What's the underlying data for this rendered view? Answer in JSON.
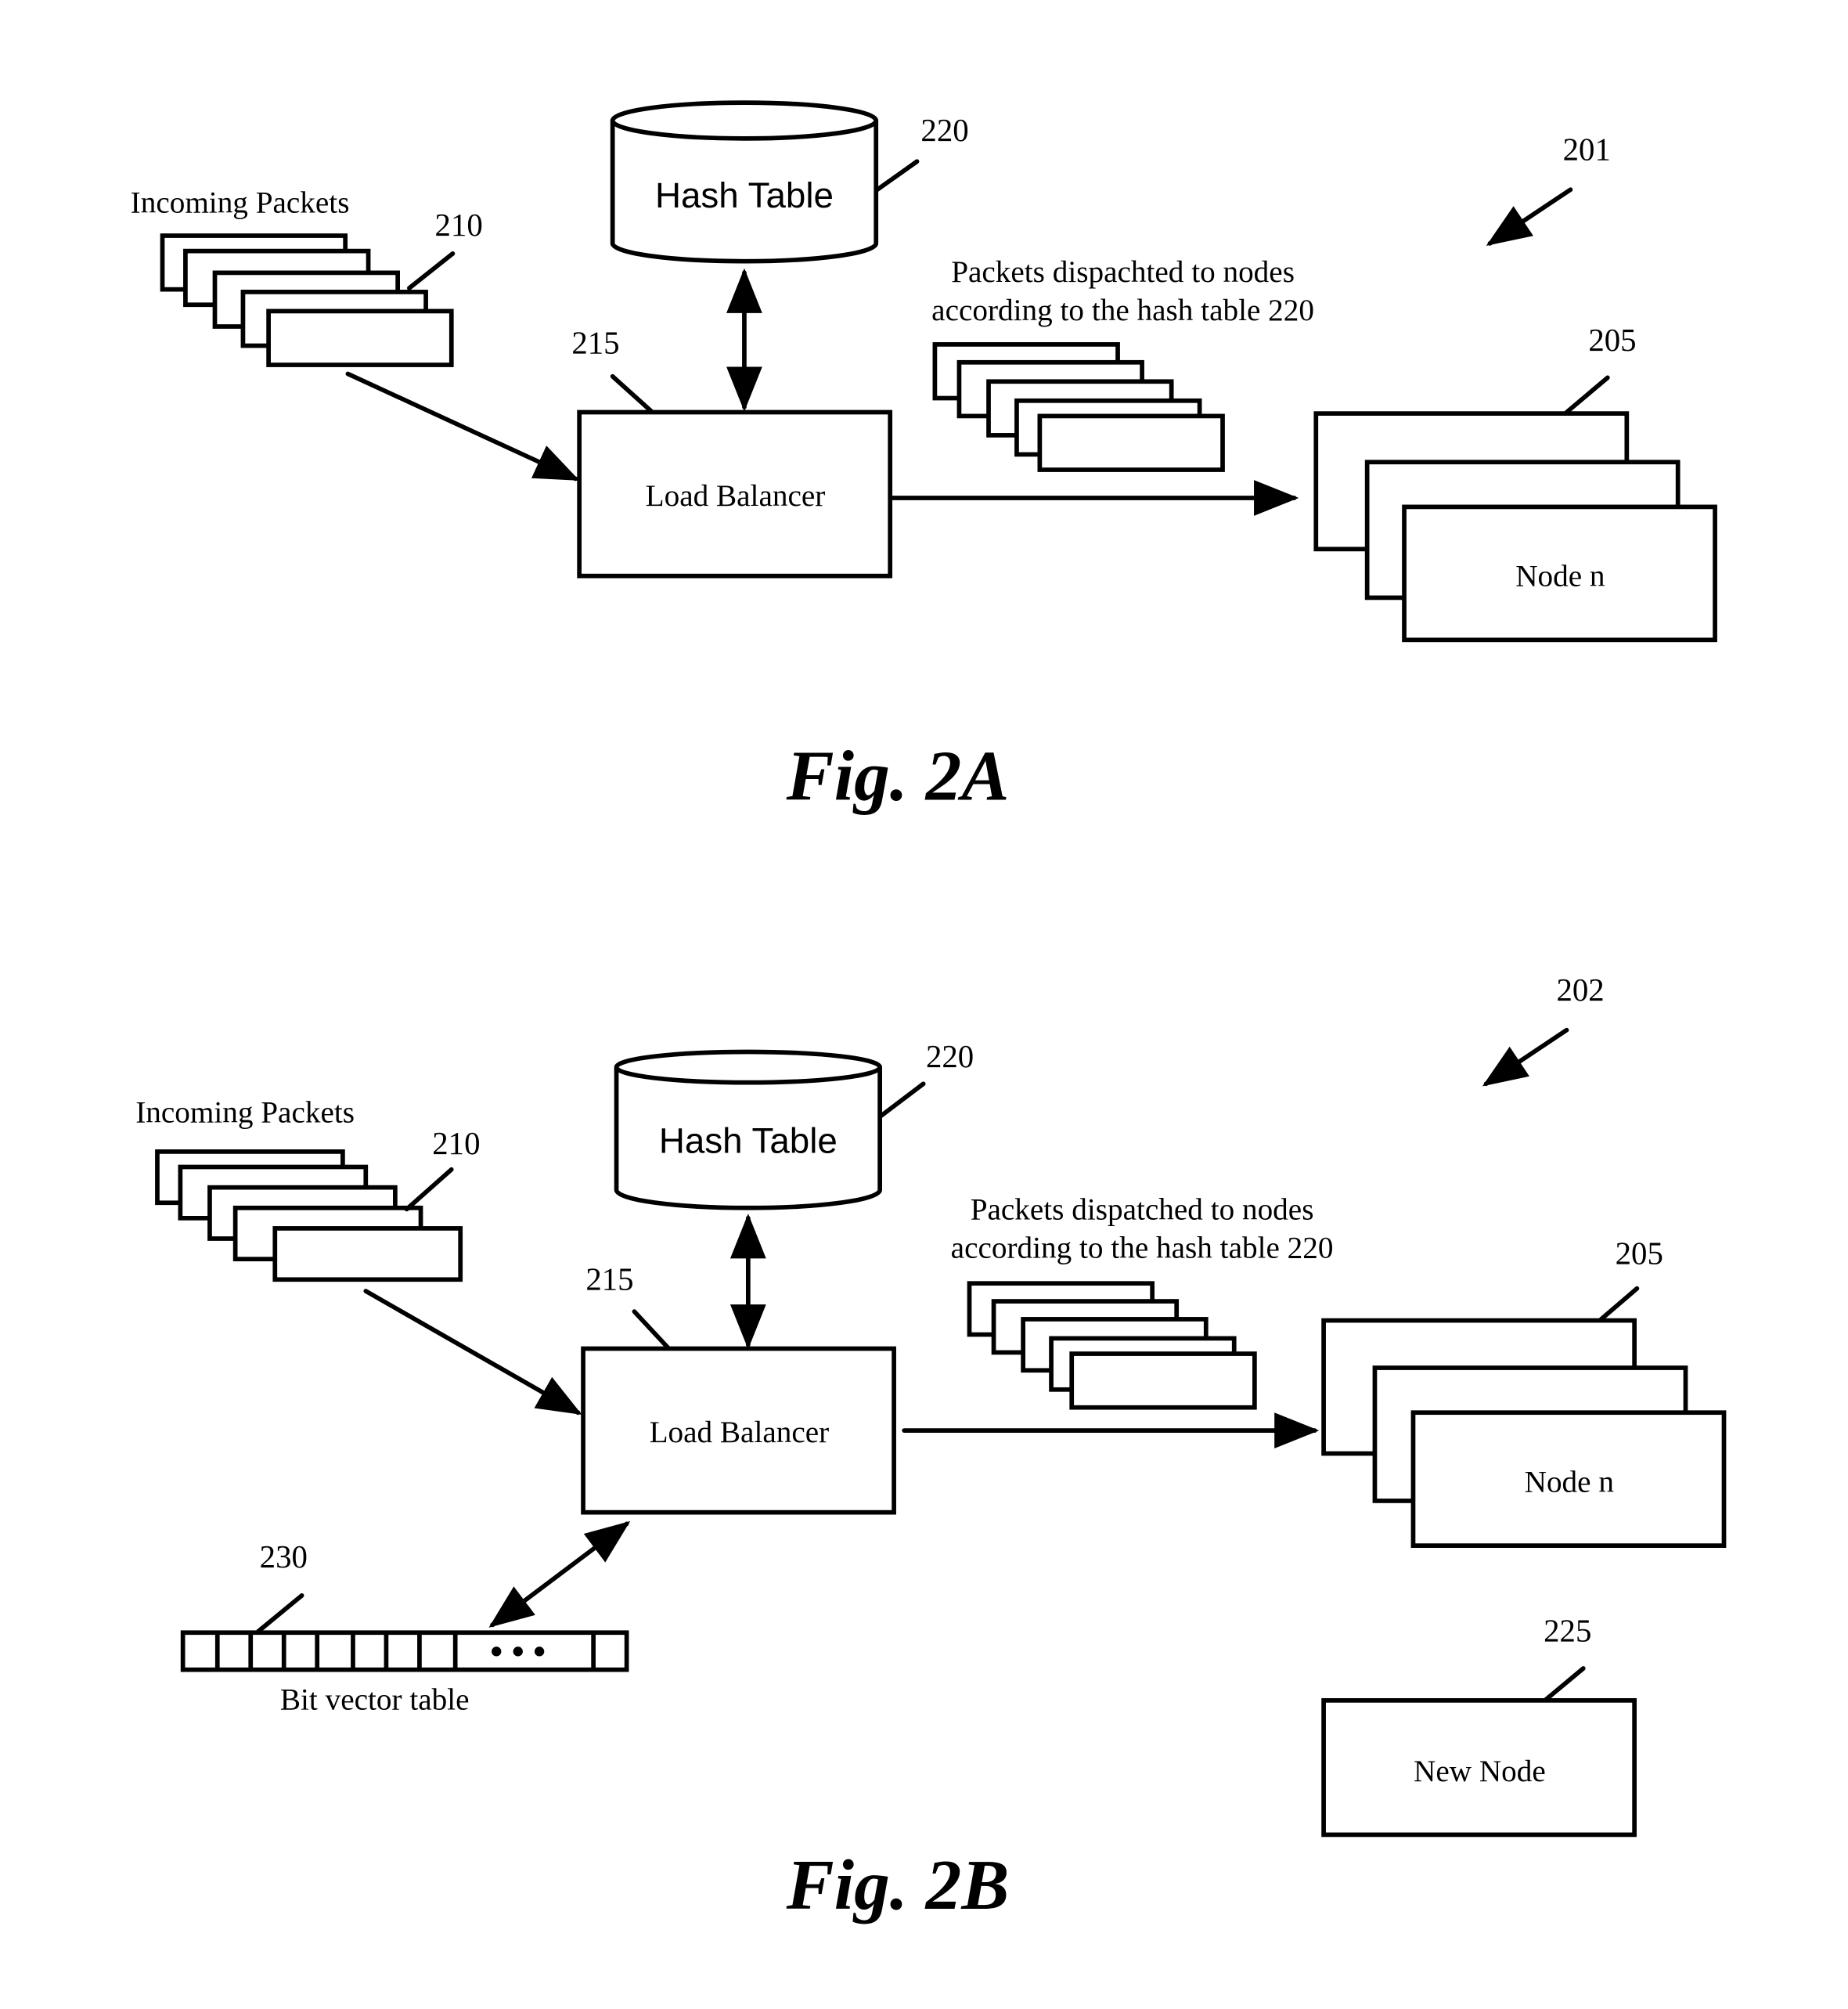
{
  "figures": [
    {
      "id": "2A",
      "caption": "Fig. 2A",
      "ref_overall": "201",
      "incoming_label": "Incoming Packets",
      "ref_incoming": "210",
      "hash_table_label": "Hash Table",
      "ref_hash_table": "220",
      "load_balancer_label": "Load Balancer",
      "ref_load_balancer": "215",
      "dispatch_label_line1": "Packets dispachted  to nodes",
      "dispatch_label_line2": "according to the hash table 220",
      "node_label": "Node n",
      "ref_nodes": "205"
    },
    {
      "id": "2B",
      "caption": "Fig. 2B",
      "ref_overall": "202",
      "incoming_label": "Incoming Packets",
      "ref_incoming": "210",
      "hash_table_label": "Hash Table",
      "ref_hash_table": "220",
      "load_balancer_label": "Load Balancer",
      "ref_load_balancer": "215",
      "dispatch_label_line1": "Packets dispatched to nodes",
      "dispatch_label_line2": "according to the hash table 220",
      "node_label": "Node n",
      "ref_nodes": "205",
      "bit_vector_label": "Bit vector table",
      "ref_bit_vector": "230",
      "bit_vector_ellipsis": "• • •",
      "new_node_label": "New Node",
      "ref_new_node": "225"
    }
  ]
}
